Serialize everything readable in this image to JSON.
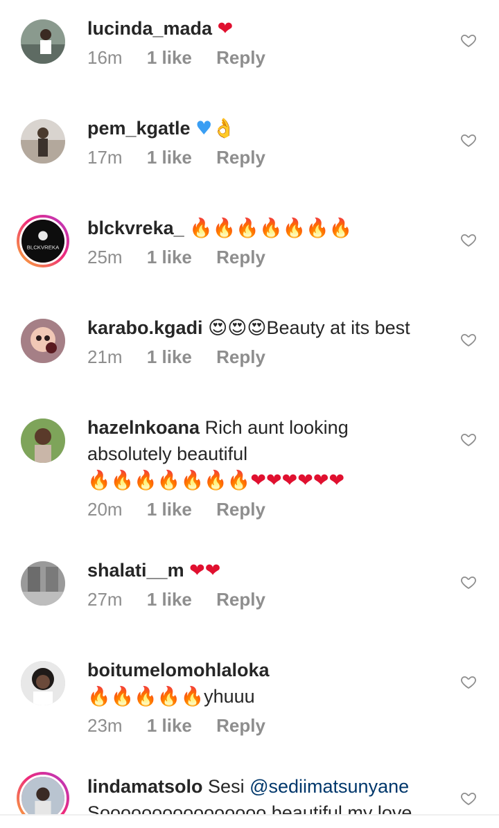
{
  "comments": [
    {
      "username": "lucinda_mada",
      "text": "",
      "emoji": "❤",
      "emoji_color": "red",
      "time": "16m",
      "likes": "1 like",
      "reply": "Reply"
    },
    {
      "username": "pem_kgatle",
      "text": "",
      "emoji": "♥👌",
      "emoji_color": "blue",
      "time": "17m",
      "likes": "1 like",
      "reply": "Reply"
    },
    {
      "username": "blckvreka_",
      "text": "",
      "emoji": "🔥🔥🔥🔥🔥🔥🔥",
      "time": "25m",
      "likes": "1 like",
      "reply": "Reply"
    },
    {
      "username": "karabo.kgadi",
      "text": "Beauty at its best",
      "emoji": "😍😍😍",
      "time": "21m",
      "likes": "1 like",
      "reply": "Reply"
    },
    {
      "username": "hazelnkoana",
      "text": "Rich aunt looking",
      "text_line2": "absolutely beautiful",
      "emoji_fire": "🔥🔥🔥🔥🔥🔥🔥",
      "emoji_hearts": "❤❤❤❤❤❤",
      "time": "20m",
      "likes": "1 like",
      "reply": "Reply"
    },
    {
      "username": "shalati__m",
      "text": "",
      "emoji": "❤❤",
      "time": "27m",
      "likes": "1 like",
      "reply": "Reply"
    },
    {
      "username": "boitumelomohlaloka",
      "text": "yhuuu",
      "emoji": "🔥🔥🔥🔥🔥",
      "time": "23m",
      "likes": "1 like",
      "reply": "Reply"
    },
    {
      "username": "lindamatsolo",
      "text": "Sesi",
      "mention": "@sediimatsunyane",
      "text_line2": "Soooooooooooooooo beautiful my love"
    }
  ],
  "avatar_logo_text": "BLCKVREKA",
  "colors": {
    "username": "#262626",
    "meta": "#8e8e8e",
    "mention": "#00376b",
    "heart": "#e0102f"
  }
}
